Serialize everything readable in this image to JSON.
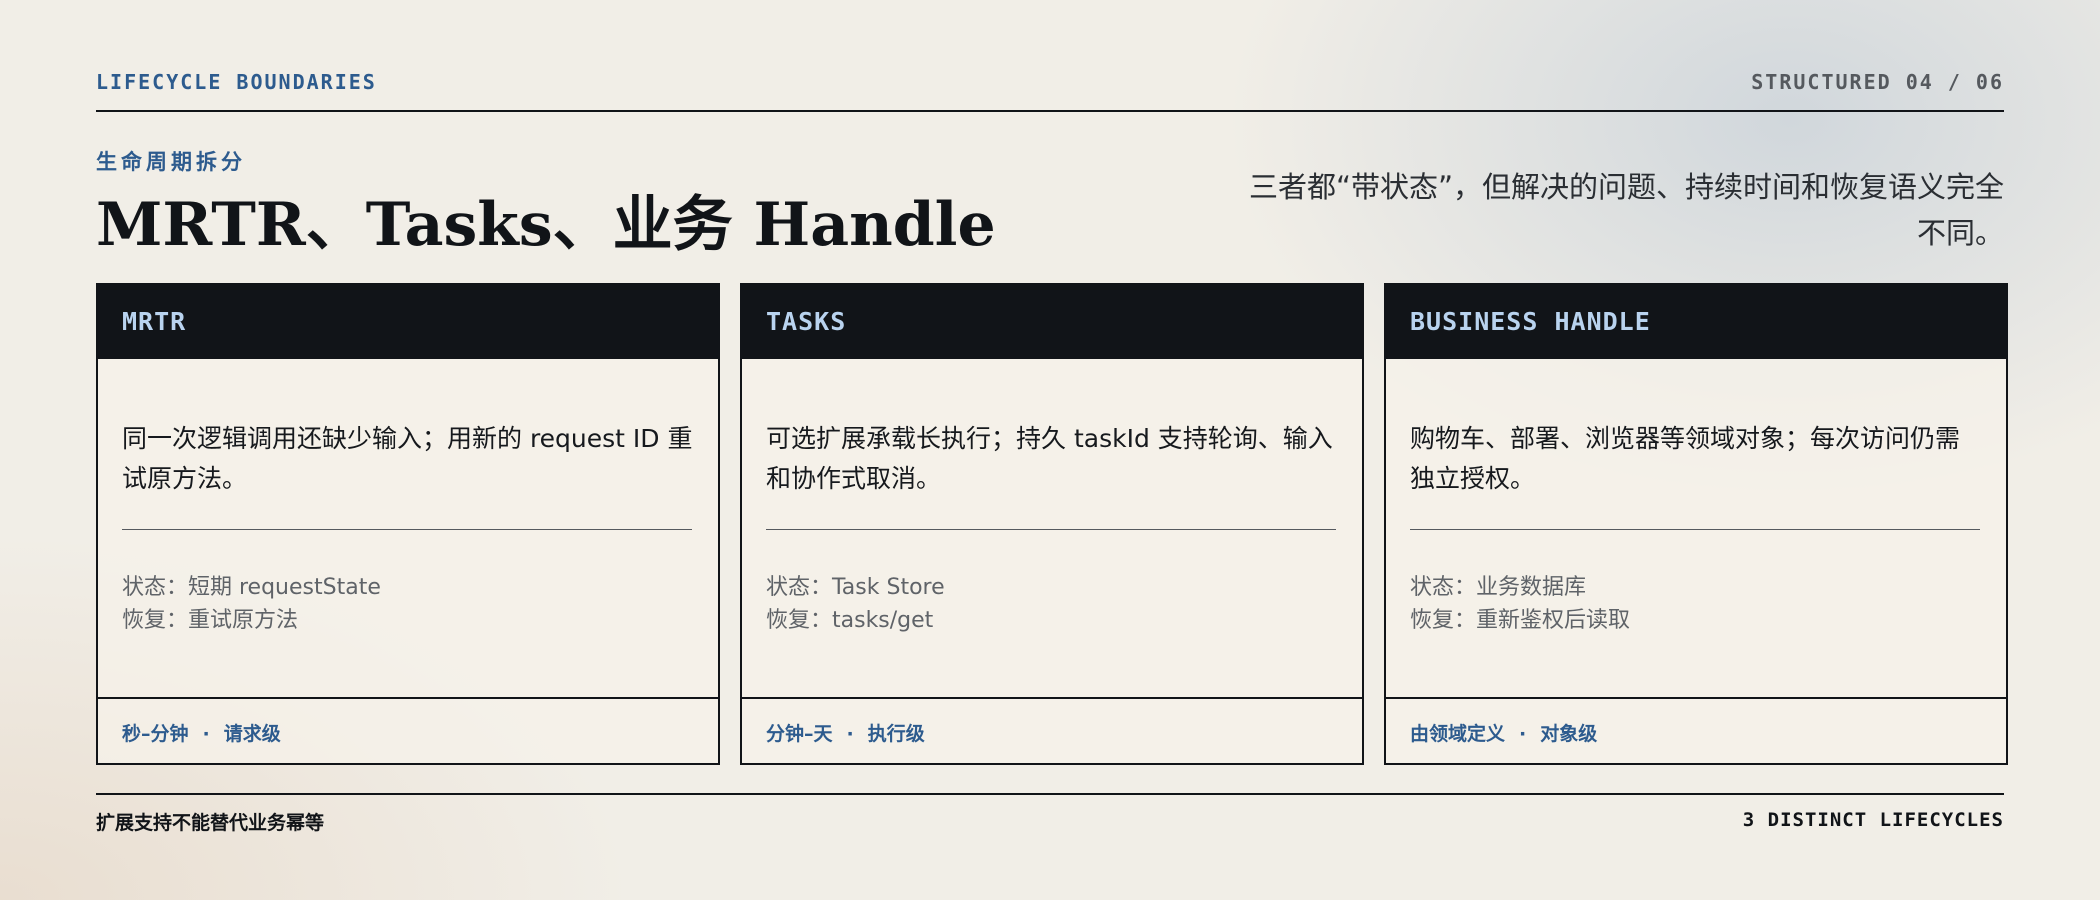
{
  "header": {
    "kicker": "LIFECYCLE BOUNDARIES",
    "page_indicator": "STRUCTURED 04 / 06",
    "subtitle": "生命周期拆分",
    "title": "MRTR、Tasks、业务 Handle",
    "lede": "三者都“带状态”，但解决的问题、持续时间和恢复语义完全不同。"
  },
  "cards": [
    {
      "label": "MRTR",
      "description": "同一次逻辑调用还缺少输入；用新的 request ID 重试原方法。",
      "state": "状态：短期 requestState",
      "recovery": "恢复：重试原方法",
      "duration": "秒–分钟",
      "separator": "·",
      "scope": "请求级"
    },
    {
      "label": "TASKS",
      "description": "可选扩展承载长执行；持久 taskId 支持轮询、输入和协作式取消。",
      "state": "状态：Task Store",
      "recovery": "恢复：tasks/get",
      "duration": "分钟–天",
      "separator": "·",
      "scope": "执行级"
    },
    {
      "label": "BUSINESS HANDLE",
      "description": "购物车、部署、浏览器等领域对象；每次访问仍需独立授权。",
      "state": "状态：业务数据库",
      "recovery": "恢复：重新鉴权后读取",
      "duration": "由领域定义",
      "separator": "·",
      "scope": "对象级"
    }
  ],
  "footer": {
    "note": "扩展支持不能替代业务幂等",
    "count": "3 DISTINCT LIFECYCLES"
  }
}
